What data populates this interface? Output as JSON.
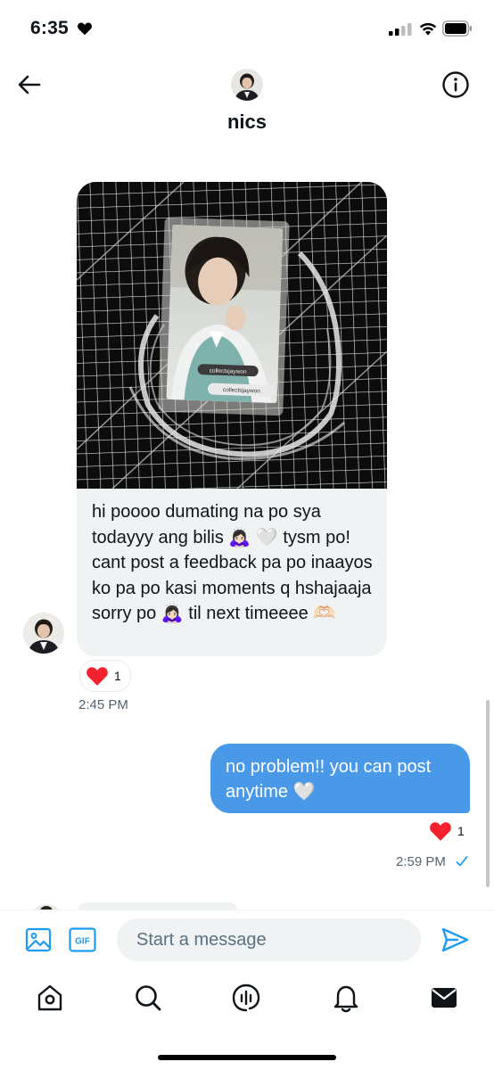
{
  "status_bar": {
    "time": "6:35"
  },
  "header": {
    "name": "nics"
  },
  "messages": {
    "received": {
      "photo_card_labels": [
        "collectsjaywon",
        "collectsjaywon"
      ],
      "text": "hi poooo dumating na po sya todayyy ang bilis 🙇🏻‍♀️ 🤍 tysm po! cant post a feedback pa po inaayos ko pa po kasi moments q hshajaaja sorry po 🙇🏻‍♀️ til next timeeee 🫶🏻",
      "reaction_count": "1",
      "time": "2:45 PM"
    },
    "sent": {
      "text": "no problem!! you can post anytime 🤍",
      "reaction_count": "1",
      "time": "2:59 PM"
    }
  },
  "composer": {
    "placeholder": "Start a message",
    "gif_label": "GIF"
  },
  "tabs": [
    "home-icon",
    "search-icon",
    "spaces-icon",
    "notifications-icon",
    "messages-icon"
  ],
  "colors": {
    "accent": "#1d9bf0",
    "sent_bubble": "#4a99e9",
    "heart": "#f4212e"
  }
}
